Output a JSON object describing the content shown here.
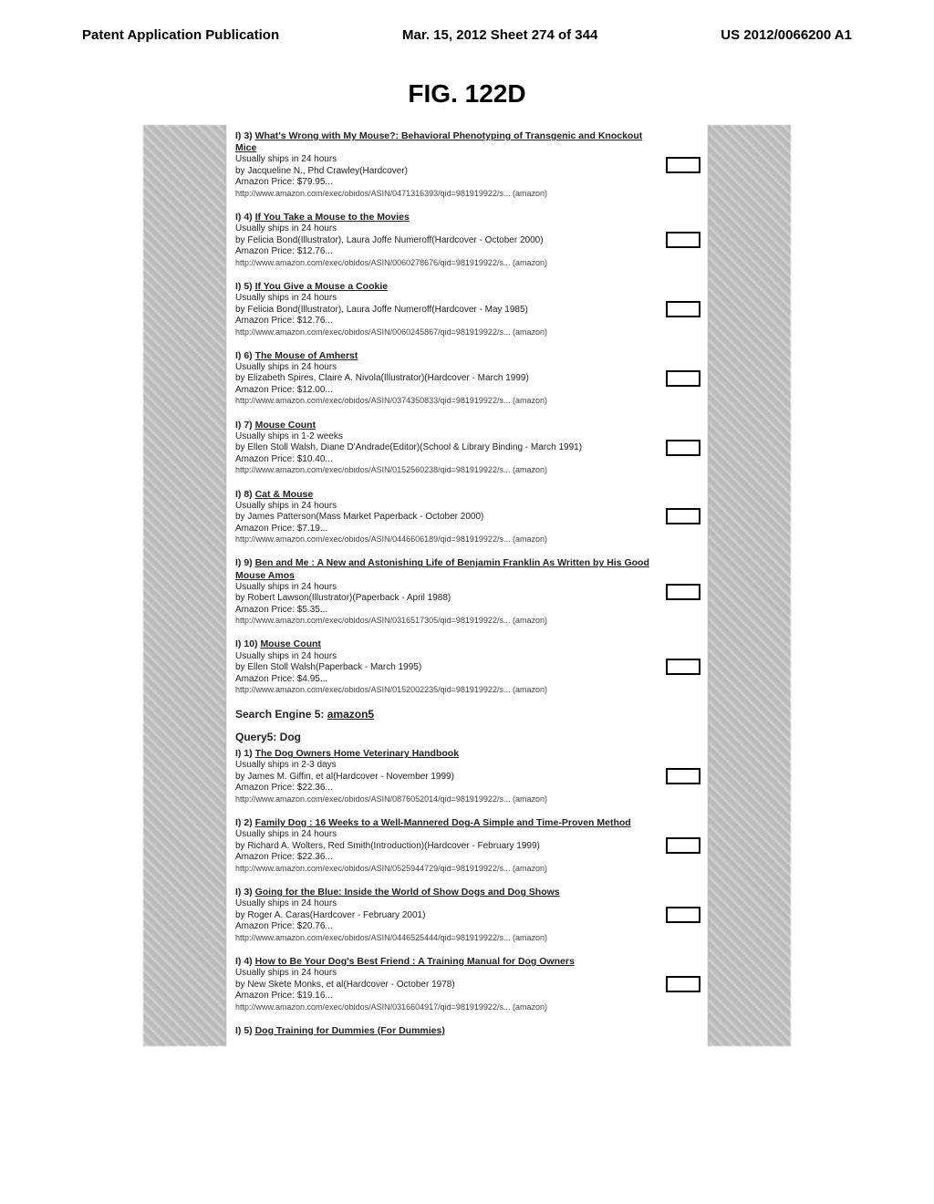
{
  "header": {
    "left": "Patent Application Publication",
    "center": "Mar. 15, 2012  Sheet 274 of 344",
    "right": "US 2012/0066200 A1"
  },
  "figure_title": "FIG. 122D",
  "items": [
    {
      "prefix": "I) 3)",
      "title": "What's Wrong with My Mouse?: Behavioral Phenotyping of Transgenic and Knockout Mice",
      "ship": "Usually ships in 24 hours",
      "byline": "by Jacqueline N., Phd Crawley(Hardcover)",
      "price": "Amazon Price: $79.95...",
      "url": "http://www.amazon.com/exec/obidos/ASIN/0471316393/qid=981919922/s...   (amazon)"
    },
    {
      "prefix": "I) 4)",
      "title": "If You Take a Mouse to the Movies",
      "ship": "Usually ships in 24 hours",
      "byline": "by Felicia Bond(Illustrator), Laura Joffe Numeroff(Hardcover - October 2000)",
      "price": "Amazon Price: $12.76...",
      "url": "http://www.amazon.com/exec/obidos/ASIN/0060278676/qid=981919922/s...   (amazon)"
    },
    {
      "prefix": "I) 5)",
      "title": "If You Give a Mouse a Cookie",
      "ship": "Usually ships in 24 hours",
      "byline": "by Felicia Bond(Illustrator), Laura Joffe Numeroff(Hardcover - May 1985)",
      "price": "Amazon Price: $12.76...",
      "url": "http://www.amazon.com/exec/obidos/ASIN/0060245867/qid=981919922/s...   (amazon)"
    },
    {
      "prefix": "I) 6)",
      "title": "The Mouse of Amherst",
      "ship": "Usually ships in 24 hours",
      "byline": "by Elizabeth Spires, Claire A. Nivola(Illustrator)(Hardcover - March 1999)",
      "price": "Amazon Price: $12.00...",
      "url": "http://www.amazon.com/exec/obidos/ASIN/0374350833/qid=981919922/s...   (amazon)"
    },
    {
      "prefix": "I) 7)",
      "title": "Mouse Count",
      "ship": "Usually ships in 1-2 weeks",
      "byline": "by Ellen Stoll Walsh, Diane D'Andrade(Editor)(School & Library Binding - March 1991)",
      "price": "Amazon Price: $10.40...",
      "url": "http://www.amazon.com/exec/obidos/ASIN/0152560238/qid=981919922/s...   (amazon)"
    },
    {
      "prefix": "I) 8)",
      "title": "Cat & Mouse",
      "ship": "Usually ships in 24 hours",
      "byline": "by James Patterson(Mass Market Paperback - October 2000)",
      "price": "Amazon Price: $7.19...",
      "url": "http://www.amazon.com/exec/obidos/ASIN/0446606189/qid=981919922/s...   (amazon)"
    },
    {
      "prefix": "I) 9)",
      "title": "Ben and Me : A New and Astonishing Life of Benjamin Franklin As Written by His Good Mouse Amos",
      "ship": "Usually ships in 24 hours",
      "byline": "by Robert Lawson(Illustrator)(Paperback - April 1988)",
      "price": "Amazon Price: $5.35...",
      "url": "http://www.amazon.com/exec/obidos/ASIN/0316517305/qid=981919922/s...   (amazon)"
    },
    {
      "prefix": "I) 10)",
      "title": "Mouse Count",
      "ship": "Usually ships in 24 hours",
      "byline": "by Ellen Stoll Walsh(Paperback - March 1995)",
      "price": "Amazon Price: $4.95...",
      "url": "http://www.amazon.com/exec/obidos/ASIN/0152002235/qid=981919922/s...   (amazon)"
    }
  ],
  "section": {
    "engine_label": "Search Engine 5:",
    "engine_name": "amazon5",
    "query_label": "Query5: Dog"
  },
  "items2": [
    {
      "prefix": "I) 1)",
      "title": "The Dog Owners Home Veterinary Handbook",
      "ship": "Usually ships in 2-3 days",
      "byline": "by James M. Giffin, et al(Hardcover - November 1999)",
      "price": "Amazon Price: $22.36...",
      "url": "http://www.amazon.com/exec/obidos/ASIN/0876052014/qid=981919922/s...   (amazon)"
    },
    {
      "prefix": "I) 2)",
      "title": "Family Dog : 16 Weeks to a Well-Mannered Dog-A Simple and Time-Proven Method",
      "ship": "Usually ships in 24 hours",
      "byline": "by Richard A. Wolters, Red Smith(Introduction)(Hardcover - February 1999)",
      "price": "Amazon Price: $22.36...",
      "url": "http://www.amazon.com/exec/obidos/ASIN/0525944729/qid=981919922/s...   (amazon)"
    },
    {
      "prefix": "I) 3)",
      "title": "Going for the Blue: Inside the World of Show Dogs and Dog Shows",
      "ship": "Usually ships in 24 hours",
      "byline": "by Roger A. Caras(Hardcover - February 2001)",
      "price": "Amazon Price: $20.76...",
      "url": "http://www.amazon.com/exec/obidos/ASIN/0446525444/qid=981919922/s...   (amazon)"
    },
    {
      "prefix": "I) 4)",
      "title": "How to Be Your Dog's Best Friend : A Training Manual for Dog Owners",
      "ship": "Usually ships in 24 hours",
      "byline": "by New Skete Monks, et al(Hardcover - October 1978)",
      "price": "Amazon Price: $19.16...",
      "url": "http://www.amazon.com/exec/obidos/ASIN/0316604917/qid=981919922/s...   (amazon)"
    }
  ],
  "trailing": {
    "prefix": "I) 5)",
    "title": "Dog Training for Dummies (For Dummies)"
  }
}
